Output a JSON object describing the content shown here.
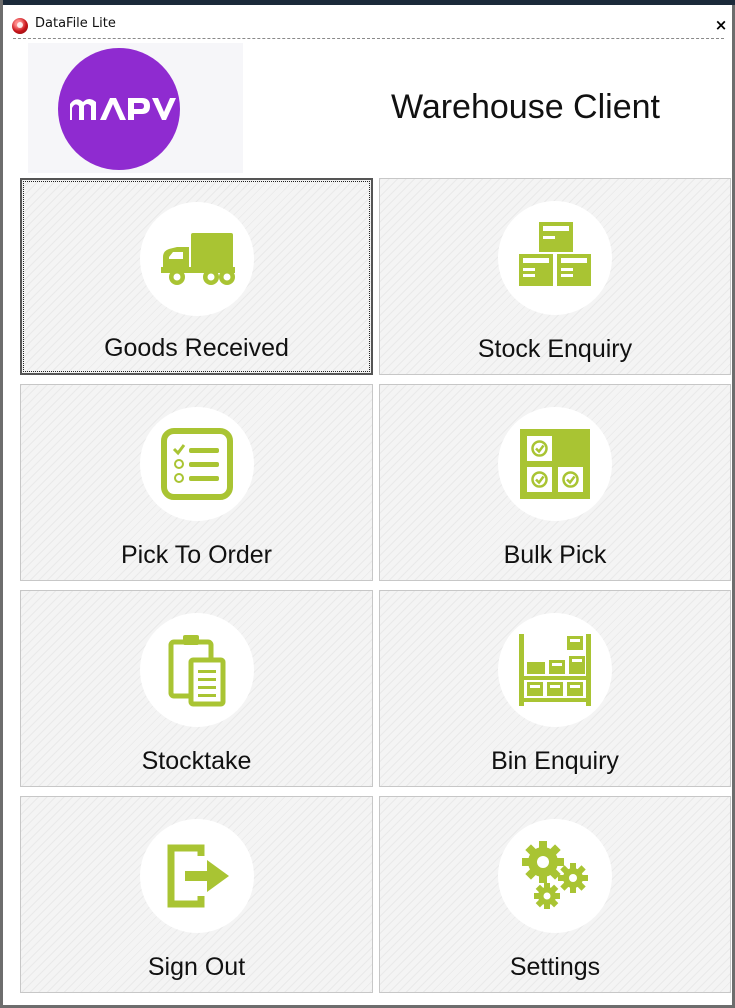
{
  "window": {
    "title": "DataFile Lite",
    "close_glyph": "×"
  },
  "header": {
    "logo_text": "MAPV",
    "title": "Warehouse Client"
  },
  "colors": {
    "accent": "#a9c433",
    "logo_purple": "#8f2bd0"
  },
  "tiles": [
    {
      "label": "Goods Received",
      "icon": "truck-icon"
    },
    {
      "label": "Stock Enquiry",
      "icon": "boxes-icon"
    },
    {
      "label": "Pick To Order",
      "icon": "checklist-icon"
    },
    {
      "label": "Bulk Pick",
      "icon": "grid-check-icon"
    },
    {
      "label": "Stocktake",
      "icon": "clipboard-icon"
    },
    {
      "label": "Bin Enquiry",
      "icon": "shelving-icon"
    },
    {
      "label": "Sign Out",
      "icon": "sign-out-icon"
    },
    {
      "label": "Settings",
      "icon": "gears-icon"
    }
  ]
}
